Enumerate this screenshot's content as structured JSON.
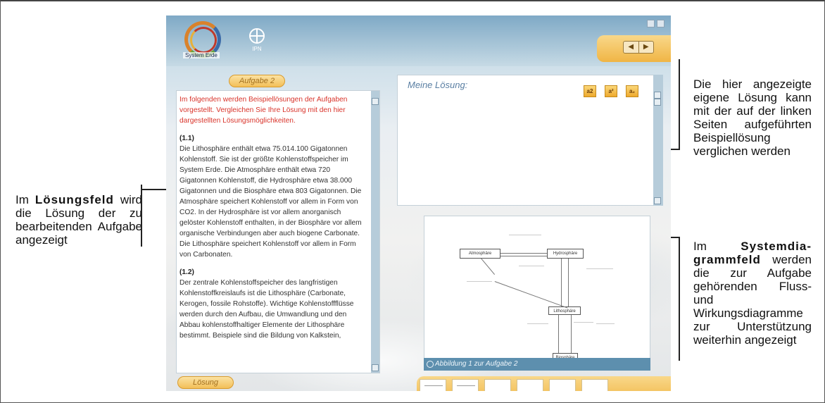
{
  "annotations": {
    "left": {
      "prefix": "Im ",
      "bold": "Lösungsfeld",
      "rest": " wird die Lösung der zu bearbeitenden Aufgabe angezeigt"
    },
    "right_top": "Die hier angezeigte eigene Lösung kann mit der auf der linken Seiten aufgeführten Beispiellösung verglichen werden",
    "right_bottom": {
      "prefix": "Im ",
      "bold": "Systemdia-grammfeld",
      "rest": " werden die zur Aufgabe gehörenden Fluss- und Wirkungsdiagramme zur Unterstützung weiterhin angezeigt"
    }
  },
  "app": {
    "logo_text": "System Erde",
    "ipn_label": "IPN",
    "nav_prev": "◀",
    "nav_next": "▶",
    "task_tab": "Aufgabe 2",
    "solution_button": "Lösung",
    "intro_text": "Im folgenden werden Beispiellösungen der Aufgaben vorgestellt. Vergleichen Sie Ihre Lösung mit den hier dargestellten Lösungsmöglichkeiten.",
    "section1_head": "(1.1)",
    "section1_text": "Die Lithosphäre enthält etwa 75.014.100 Gigatonnen Kohlenstoff. Sie ist der größte Kohlenstoffspeicher im System Erde. Die Atmosphäre enthält etwa 720 Gigatonnen Kohlenstoff, die Hydrosphäre etwa 38.000 Gigatonnen und die Biosphäre etwa 803 Gigatonnen. Die Atmosphäre speichert Kohlenstoff vor allem in Form von CO2. In der Hydrosphäre ist vor allem anorganisch gelöster Kohlenstoff enthalten, in der Biosphäre vor allem organische Verbindungen aber auch biogene Carbonate. Die Lithosphäre speichert Kohlenstoff vor allem in Form von Carbonaten.",
    "section2_head": "(1.2)",
    "section2_text": "Der zentrale Kohlenstoffspeicher des langfristigen Kohlenstoffkreislaufs ist die Lithosphäre (Carbonate, Kerogen, fossile Rohstoffe). Wichtige Kohlenstoffflüsse werden durch den Aufbau, die Umwandlung und den Abbau kohlenstoffhaltiger Elemente der Lithosphäre bestimmt. Beispiele sind die Bildung von Kalkstein,",
    "solution_title": "Meine Lösung:",
    "format_buttons": [
      "a2",
      "a²",
      "a₂"
    ],
    "diagram_caption": "Abbildung 1 zur Aufgabe 2",
    "diagram": {
      "atmosphere": "Atmosphäre",
      "hydrosphere": "Hydrosphäre",
      "lithosphere": "Lithosphäre",
      "biosphere": "Biosphäre"
    }
  }
}
